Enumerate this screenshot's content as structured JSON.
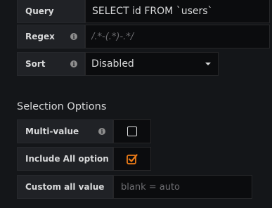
{
  "query": {
    "label": "Query",
    "value": "SELECT id FROM `users`"
  },
  "regex": {
    "label": "Regex",
    "placeholder": "/.*-(.*)-.*/",
    "info_icon": "info-icon"
  },
  "sort": {
    "label": "Sort",
    "selected": "Disabled",
    "info_icon": "info-icon"
  },
  "selection": {
    "title": "Selection Options",
    "multi_value": {
      "label": "Multi-value",
      "checked": false
    },
    "include_all": {
      "label": "Include All option",
      "checked": true,
      "accent": "#eb7b18"
    },
    "custom_all": {
      "label": "Custom all value",
      "placeholder": "blank = auto"
    }
  },
  "info_glyph": "i"
}
